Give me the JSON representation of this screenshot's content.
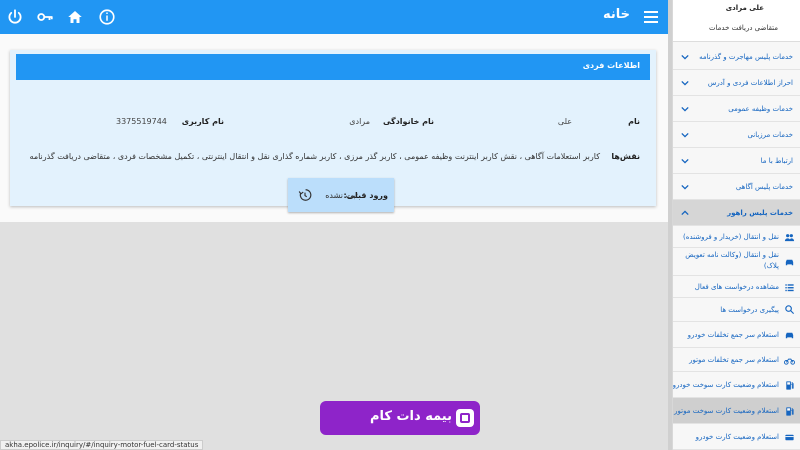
{
  "header": {
    "title": "خانه",
    "icons": [
      "power-icon",
      "key-icon",
      "home-icon",
      "info-icon",
      "menu-icon"
    ]
  },
  "card": {
    "title": "اطلاعات فردی",
    "first_name_label": "نام",
    "first_name_value": "علی",
    "last_name_label": "نام خانوادگی",
    "last_name_value": "مرادی",
    "username_label": "نام کاربری",
    "username_value": "3375519744",
    "roles_label": "نقش‌ها",
    "roles_value": "کاربر استعلامات آگاهی ، نقش کاربر اینترنت وظیفه عمومی ، کاربر گذر مرزی ، کاربر شماره گذاری نقل و انتقال اینترنتی ، تکمیل مشخصات فردی ، متقاضی دریافت گذرنامه",
    "last_login_label": "ورود قبلی:",
    "last_login_value": "ثبت نشده"
  },
  "sidebar": {
    "user_name": "علی مرادی",
    "user_role": "متقاضی دریافت خدمات",
    "items": [
      {
        "label": "خدمات پلیس مهاجرت و گذرنامه",
        "chevron": true
      },
      {
        "label": "احراز اطلاعات فردی و آدرس",
        "chevron": true
      },
      {
        "label": "خدمات وظیفه عمومی",
        "chevron": true
      },
      {
        "label": "خدمات مرزبانی",
        "chevron": true
      },
      {
        "label": "ارتباط با ما",
        "chevron": true
      },
      {
        "label": "خدمات پلیس آگاهی",
        "chevron": true
      },
      {
        "label": "خدمات پلیس راهور",
        "chevron": true
      }
    ],
    "sub_items": [
      {
        "label": "نقل و انتقال (خریدار و فروشنده)",
        "icon": "people-icon"
      },
      {
        "label": "نقل و انتقال (وکالت نامه تعویض",
        "label2": "پلاک)",
        "icon": "car-icon"
      },
      {
        "label": "مشاهده درخواست های فعال",
        "icon": "list-icon"
      },
      {
        "label": "پیگیری درخواست ها",
        "icon": "search-icon"
      },
      {
        "label": "استعلام سر جمع تخلفات خودرو",
        "icon": "car-icon"
      },
      {
        "label": "استعلام سر جمع تخلفات موتور",
        "icon": "motorcycle-icon"
      },
      {
        "label": "استعلام وضعیت کارت سوخت خودرو",
        "icon": "fuel-icon"
      },
      {
        "label": "استعلام وضعیت کارت سوخت موتور",
        "icon": "fuel-icon"
      },
      {
        "label": "استعلام وضعیت کارت خودرو",
        "icon": "card-icon"
      }
    ]
  },
  "status_url": "akha.epolice.ir/inquiry/#/inquiry-motor-fuel-card-status",
  "watermark": {
    "text": "بیمه دات کام"
  },
  "colors": {
    "primary": "#2196f3",
    "card_bg": "#e3f2fd",
    "watermark": "#8e24c9"
  }
}
